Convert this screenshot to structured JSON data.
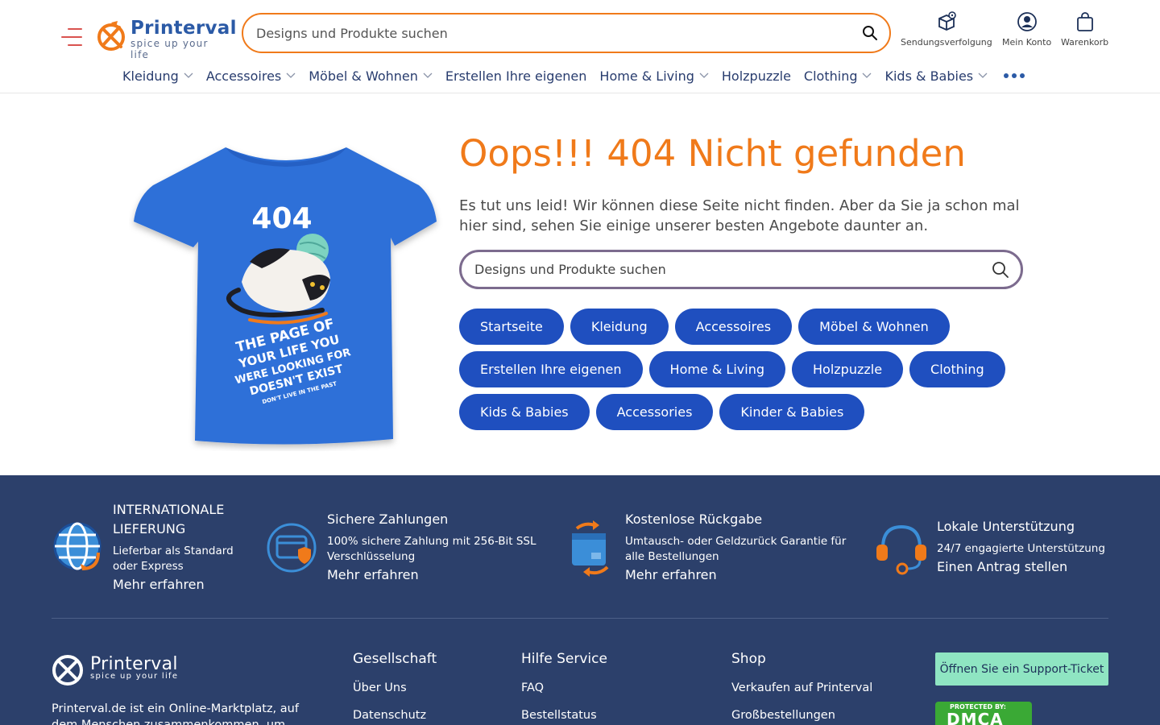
{
  "brand": {
    "name": "Printerval",
    "tagline": "spice up your life"
  },
  "header": {
    "search_placeholder": "Designs und Produkte suchen",
    "actions": [
      {
        "label": "Sendungsverfolgung",
        "icon": "package-track-icon"
      },
      {
        "label": "Mein Konto",
        "icon": "user-icon"
      },
      {
        "label": "Warenkorb",
        "icon": "bag-icon"
      }
    ]
  },
  "nav": {
    "items": [
      {
        "label": "Kleidung",
        "has_dropdown": true
      },
      {
        "label": "Accessoires",
        "has_dropdown": true
      },
      {
        "label": "Möbel & Wohnen",
        "has_dropdown": true
      },
      {
        "label": "Erstellen Ihre eigenen",
        "has_dropdown": false
      },
      {
        "label": "Home & Living",
        "has_dropdown": true
      },
      {
        "label": "Holzpuzzle",
        "has_dropdown": false
      },
      {
        "label": "Clothing",
        "has_dropdown": true
      },
      {
        "label": "Kids & Babies",
        "has_dropdown": true
      }
    ]
  },
  "main": {
    "title": "Oops!!! 404 Nicht gefunden",
    "description": "Es tut uns leid! Wir können diese Seite nicht finden. Aber da Sie ja schon mal hier sind, sehen Sie einige unserer besten Angebote daunter an.",
    "search_placeholder": "Designs und Produkte suchen",
    "shirt_text": {
      "code": "404",
      "line1": "THE PAGE OF",
      "line2": "YOUR LIFE YOU",
      "line3": "WERE LOOKING FOR",
      "line4": "DOESN'T EXIST",
      "line5": "DON'T LIVE IN THE PAST"
    },
    "pill_rows": [
      [
        "Startseite",
        "Kleidung",
        "Accessoires",
        "Möbel & Wohnen"
      ],
      [
        "Erstellen Ihre eigenen",
        "Home & Living",
        "Holzpuzzle",
        "Clothing"
      ],
      [
        "Kids & Babies",
        "Accessories",
        "Kinder & Babies"
      ]
    ]
  },
  "features": [
    {
      "title": "INTERNATIONALE LIEFERUNG",
      "subtitle": "Lieferbar als Standard oder Express",
      "link": "Mehr erfahren",
      "icon": "globe-icon"
    },
    {
      "title": "Sichere Zahlungen",
      "subtitle": "100% sichere Zahlung mit 256-Bit SSL Verschlüsselung",
      "link": "Mehr erfahren",
      "icon": "secure-card-icon"
    },
    {
      "title": "Kostenlose Rückgabe",
      "subtitle": "Umtausch- oder Geldzurück Garantie für alle Bestellungen",
      "link": "Mehr erfahren",
      "icon": "return-box-icon"
    },
    {
      "title": "Lokale Unterstützung",
      "subtitle": "24/7 engagierte Unterstützung",
      "link": "Einen Antrag stellen",
      "icon": "headset-icon"
    }
  ],
  "footer": {
    "description": "Printerval.de ist ein Online-Marktplatz, auf dem Menschen zusammenkommen, um",
    "columns": [
      {
        "heading": "Gesellschaft",
        "links": [
          "Über Uns",
          "Datenschutz"
        ]
      },
      {
        "heading": "Hilfe Service",
        "links": [
          "FAQ",
          "Bestellstatus"
        ]
      },
      {
        "heading": "Shop",
        "links": [
          "Verkaufen auf Printerval",
          "Großbestellungen"
        ]
      }
    ],
    "support_ticket": "Öffnen Sie ein Support-Ticket",
    "dmca": {
      "top": "PROTECTED BY:",
      "main": "DMCA"
    }
  },
  "colors": {
    "accent": "#f07a1a",
    "pill": "#1f4fbf",
    "footer_bg": "#2c406b",
    "nav_text": "#283c6e",
    "ticket_bg": "#8fe5c2",
    "shirt": "#2f6fd8"
  }
}
